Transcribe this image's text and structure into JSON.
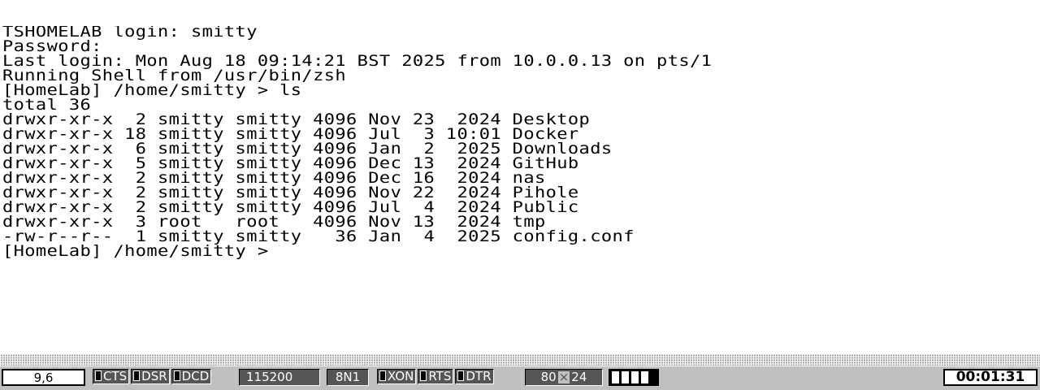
{
  "terminal": {
    "lines": [
      "TSHOMELAB login: smitty",
      "Password:",
      "Last login: Mon Aug 18 09:14:21 BST 2025 from 10.0.0.13 on pts/1",
      "Running Shell from /usr/bin/zsh",
      "[HomeLab] /home/smitty > ls",
      "total 36",
      "drwxr-xr-x  2 smitty smitty 4096 Nov 23  2024 Desktop",
      "drwxr-xr-x 18 smitty smitty 4096 Jul  3 10:01 Docker",
      "drwxr-xr-x  6 smitty smitty 4096 Jan  2  2025 Downloads",
      "drwxr-xr-x  5 smitty smitty 4096 Dec 13  2024 GitHub",
      "drwxr-xr-x  2 smitty smitty 4096 Dec 16  2024 nas",
      "drwxr-xr-x  2 smitty smitty 4096 Nov 22  2024 Pihole",
      "drwxr-xr-x  2 smitty smitty 4096 Jul  4  2024 Public",
      "drwxr-xr-x  3 root   root   4096 Nov 13  2024 tmp",
      "-rw-r--r--  1 smitty smitty   36 Jan  4  2025 config.conf",
      "[HomeLab] /home/smitty > "
    ]
  },
  "status": {
    "cursor_pos": "9,6",
    "cts": "CTS",
    "dsr": "DSR",
    "dcd": "DCD",
    "baud": "115200",
    "frame": "8N1",
    "xon": "XON",
    "rts": "RTS",
    "dtr": "DTR",
    "cols": "80",
    "times": "×",
    "rows": "24",
    "elapsed": "00:01:31"
  },
  "colors": {
    "background": "#ffffff",
    "text": "#000000",
    "statusbar": "#c0c0c0",
    "panel": "#555555"
  }
}
